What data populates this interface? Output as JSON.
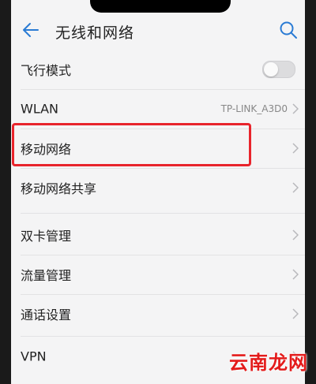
{
  "header": {
    "title": "无线和网络"
  },
  "items": [
    {
      "label": "飞行模式",
      "type": "toggle",
      "on": false
    },
    {
      "label": "WLAN",
      "value": "TP-LINK_A3D0",
      "type": "link"
    },
    {
      "label": "移动网络",
      "type": "link",
      "highlighted": true
    },
    {
      "label": "移动网络共享",
      "type": "link"
    },
    {
      "label": "双卡管理",
      "type": "link"
    },
    {
      "label": "流量管理",
      "type": "link"
    },
    {
      "label": "通话设置",
      "type": "link"
    },
    {
      "label": "VPN",
      "type": "link"
    }
  ],
  "watermark": "云南龙网",
  "colors": {
    "highlight": "#e8242c",
    "accent": "#2a7bd4",
    "watermark": "#e31b1b"
  }
}
